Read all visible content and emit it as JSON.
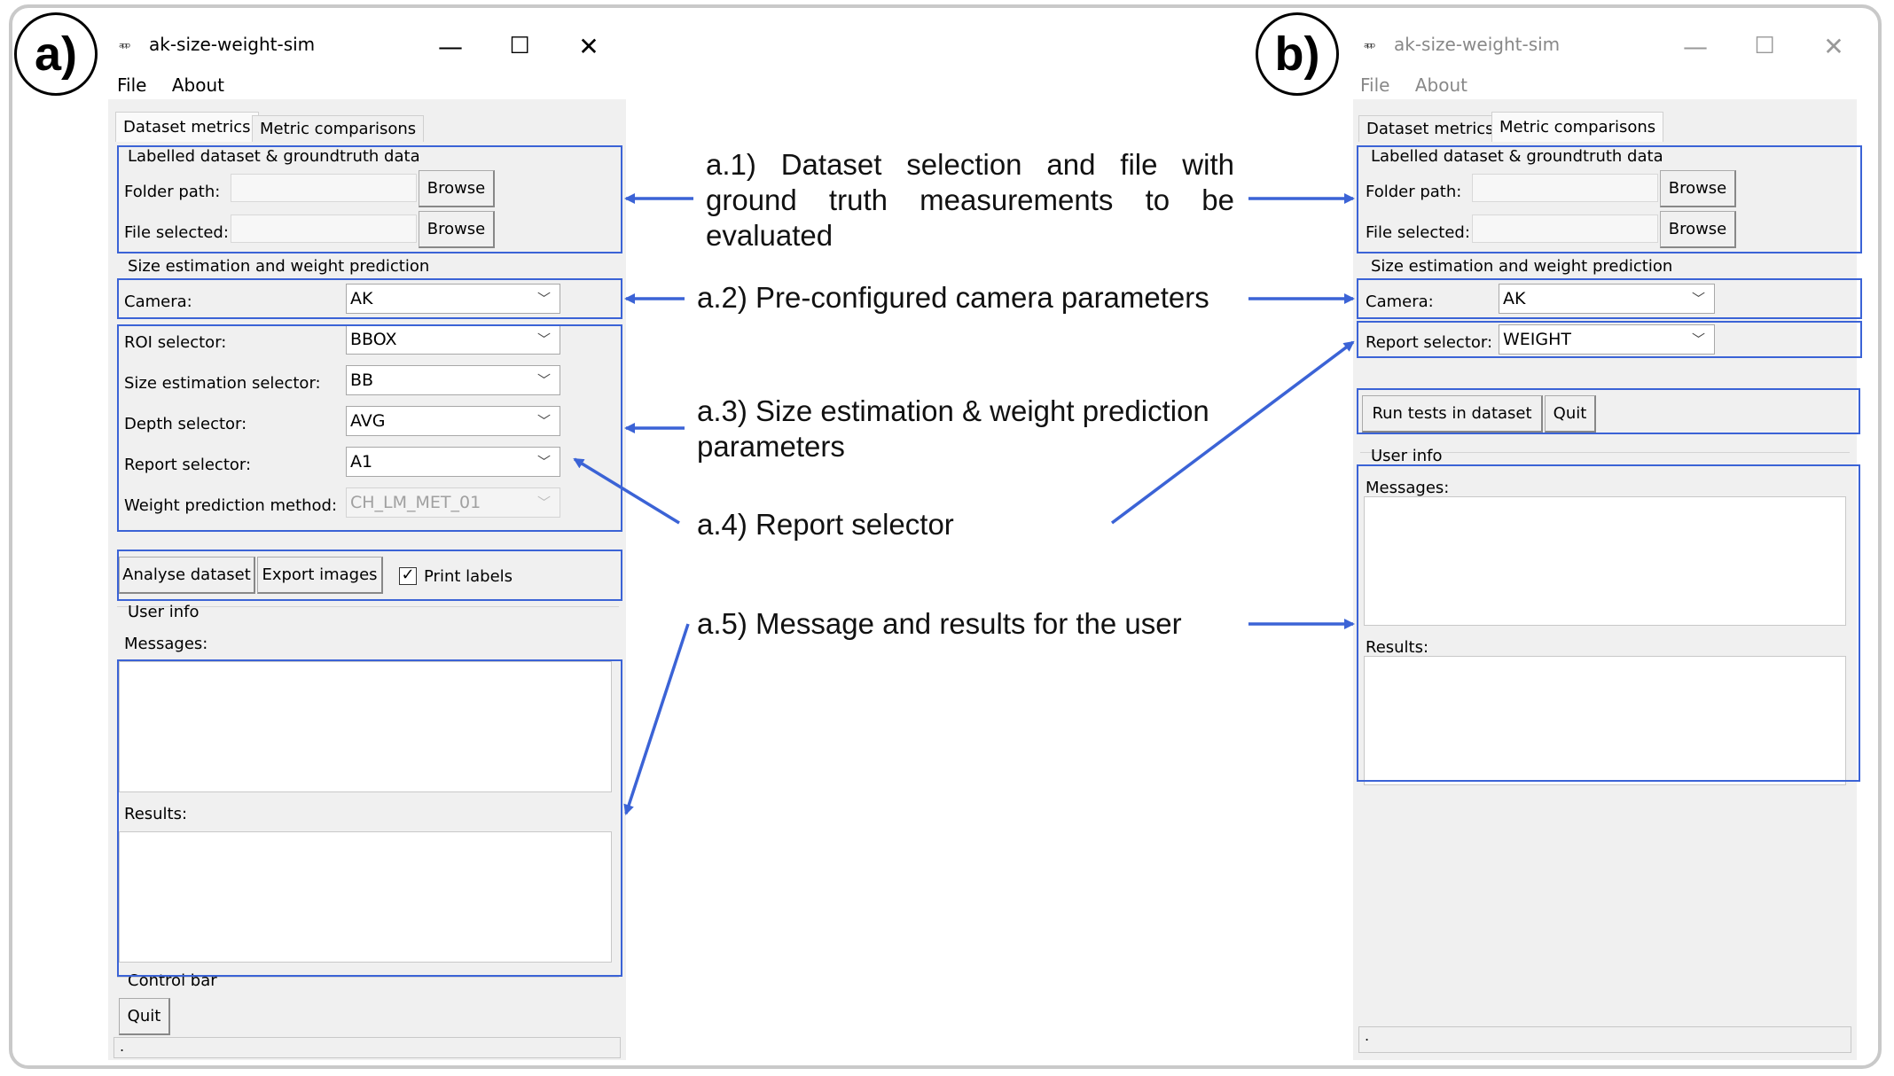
{
  "panels": {
    "a": "a)",
    "b": "b)"
  },
  "window_a": {
    "title": "ak-size-weight-sim",
    "menu": [
      "File",
      "About"
    ],
    "tabs": [
      "Dataset metrics",
      "Metric comparisons"
    ],
    "group_dataset": "Labelled dataset & groundtruth data",
    "folder_label": "Folder path:",
    "file_label": "File selected:",
    "browse": "Browse",
    "group_size": "Size estimation and weight prediction",
    "camera_label": "Camera:",
    "camera_value": "AK",
    "roi_label": "ROI selector:",
    "roi_value": "BBOX",
    "size_label": "Size estimation selector:",
    "size_value": "BB",
    "depth_label": "Depth selector:",
    "depth_value": "AVG",
    "report_label": "Report selector:",
    "report_value": "A1",
    "weight_label": "Weight prediction method:",
    "weight_value": "CH_LM_MET_01",
    "analyse_button": "Analyse dataset",
    "export_button": "Export images",
    "print_labels": "Print labels",
    "print_labels_checked": true,
    "group_userinfo": "User info",
    "messages_label": "Messages:",
    "results_label": "Results:",
    "group_control": "Control bar",
    "quit_button": "Quit",
    "status": "."
  },
  "window_b": {
    "title": "ak-size-weight-sim",
    "menu": [
      "File",
      "About"
    ],
    "tabs": [
      "Dataset metrics",
      "Metric comparisons"
    ],
    "group_dataset": "Labelled dataset & groundtruth data",
    "folder_label": "Folder path:",
    "file_label": "File selected:",
    "browse": "Browse",
    "group_size": "Size estimation and weight prediction",
    "camera_label": "Camera:",
    "camera_value": "AK",
    "report_label": "Report selector:",
    "report_value": "WEIGHT",
    "run_button": "Run tests in dataset",
    "quit_button": "Quit",
    "group_userinfo": "User info",
    "messages_label": "Messages:",
    "results_label": "Results:",
    "status": "."
  },
  "annotations": {
    "a1": "a.1) Dataset selection and file with ground truth measurements to be evaluated",
    "a2": "a.2) Pre-configured camera parameters",
    "a3": "a.3) Size estimation & weight prediction parameters",
    "a4": "a.4) Report selector",
    "a5": "a.5) Message and results for the user"
  },
  "colors": {
    "highlight": "#3b63d6",
    "arrow": "#3b63d6"
  }
}
